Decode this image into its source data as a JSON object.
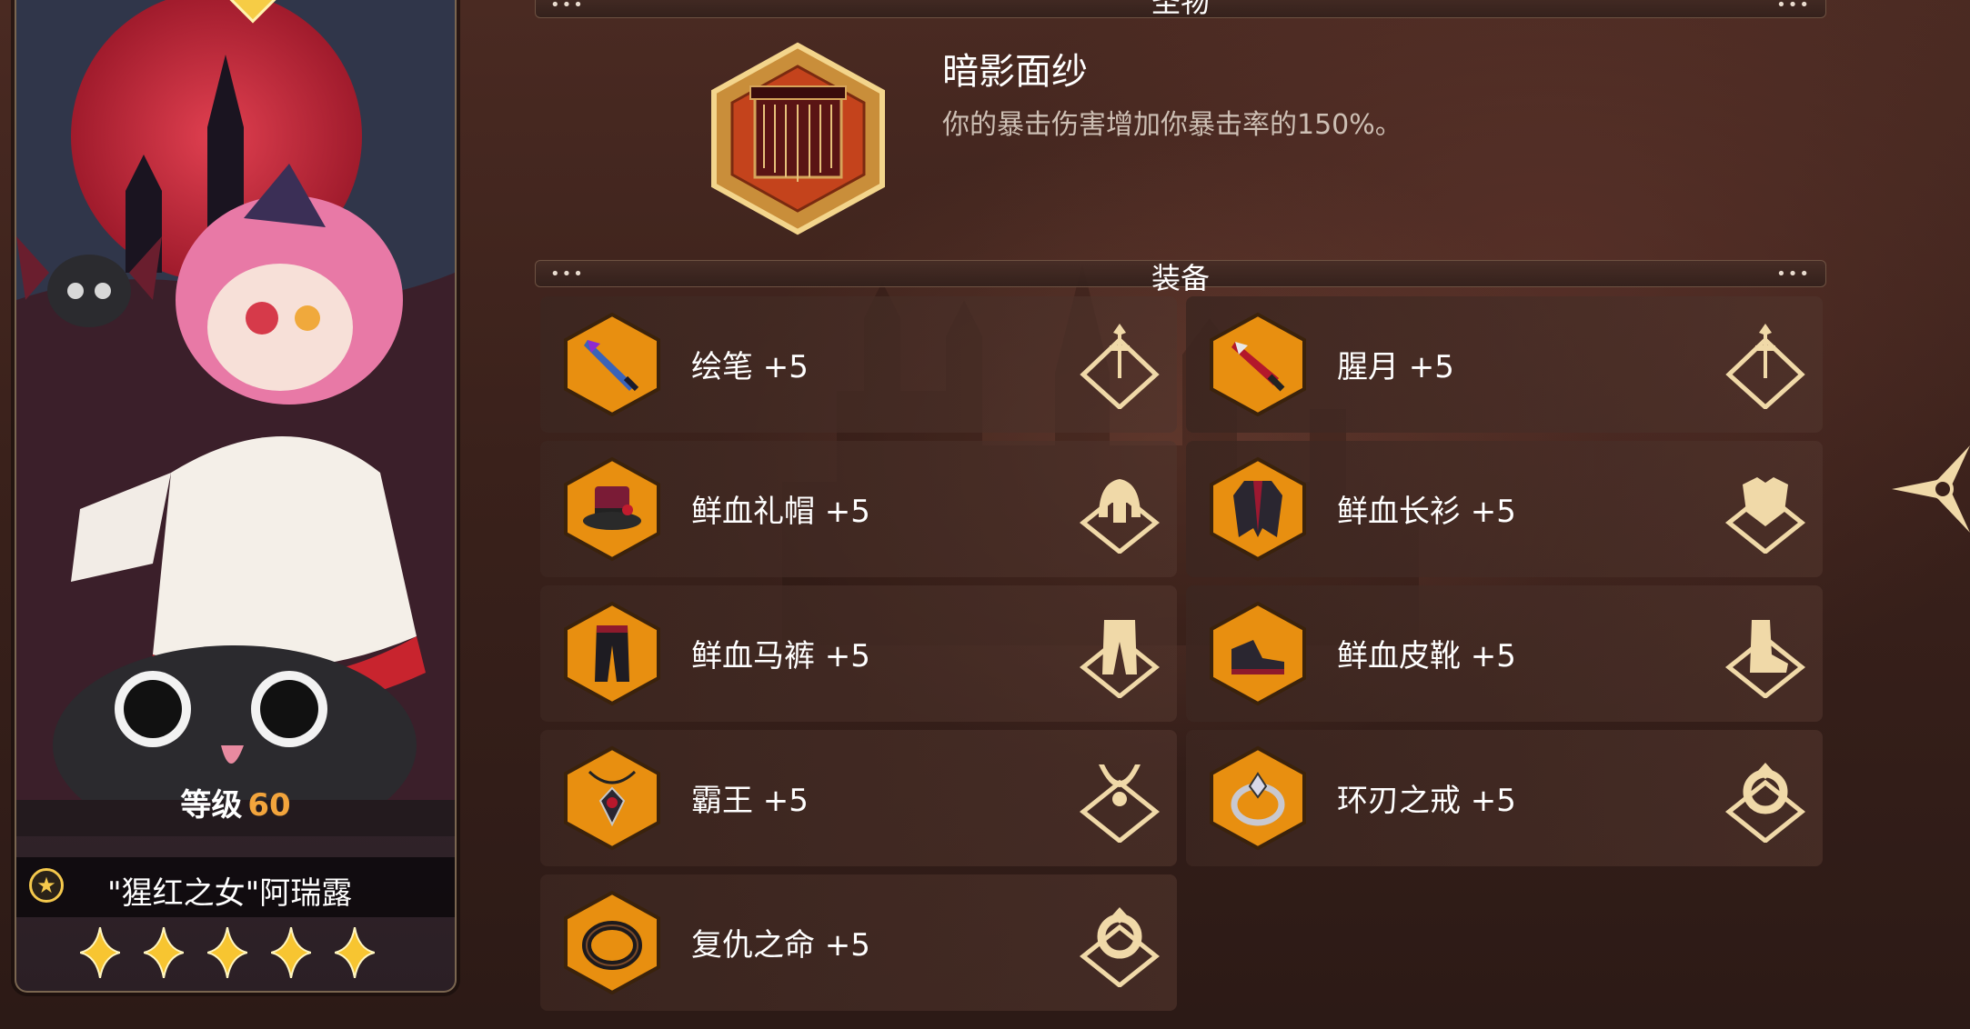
{
  "character": {
    "level_label": "等级",
    "level_value": "60",
    "name": "\"猩红之女\"阿瑞露",
    "stars": 5
  },
  "relic_section": {
    "title": "圣物",
    "relic_name": "暗影面纱",
    "relic_desc": "你的暴击伤害增加你暴击率的150%。"
  },
  "equipment_section": {
    "title": "装备",
    "items": [
      {
        "name": "绘笔 +5",
        "slot": "weapon"
      },
      {
        "name": "腥月 +5",
        "slot": "weapon"
      },
      {
        "name": "鲜血礼帽 +5",
        "slot": "helmet"
      },
      {
        "name": "鲜血长衫 +5",
        "slot": "armor"
      },
      {
        "name": "鲜血马裤 +5",
        "slot": "pants"
      },
      {
        "name": "鲜血皮靴 +5",
        "slot": "boots"
      },
      {
        "name": "霸王 +5",
        "slot": "necklace"
      },
      {
        "name": "环刃之戒 +5",
        "slot": "ring"
      },
      {
        "name": "复仇之命 +5",
        "slot": "ring"
      }
    ]
  },
  "colors": {
    "gold": "#f5a623",
    "accent_orange": "#f2a43c",
    "background": "#3a211b"
  }
}
